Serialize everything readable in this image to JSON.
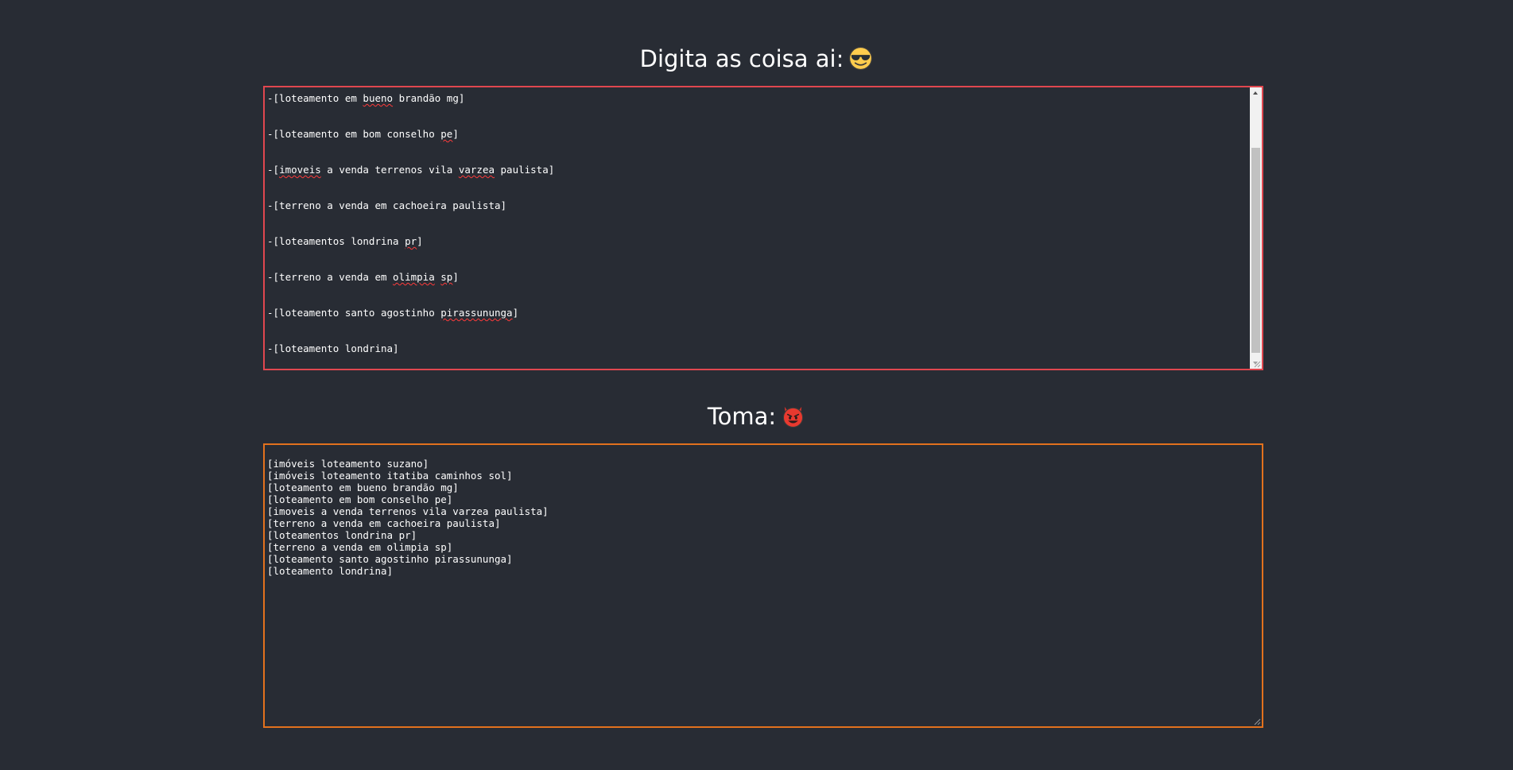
{
  "input_section": {
    "heading": "Digita as coisa ai:",
    "emoji": "smiling-face-with-sunglasses-icon",
    "border_color": "#e0474f",
    "lines": [
      [
        {
          "t": "-[loteamento em "
        },
        {
          "t": "bueno",
          "err": true
        },
        {
          "t": " brandão mg]"
        }
      ],
      [
        {
          "t": "-[loteamento em bom conselho "
        },
        {
          "t": "pe",
          "err": true
        },
        {
          "t": "]"
        }
      ],
      [
        {
          "t": "-["
        },
        {
          "t": "imoveis",
          "err": true
        },
        {
          "t": " a venda terrenos vila "
        },
        {
          "t": "varzea",
          "err": true
        },
        {
          "t": " paulista]"
        }
      ],
      [
        {
          "t": "-[terreno a venda em cachoeira paulista]"
        }
      ],
      [
        {
          "t": "-[loteamentos londrina "
        },
        {
          "t": "pr",
          "err": true
        },
        {
          "t": "]"
        }
      ],
      [
        {
          "t": "-[terreno a venda em "
        },
        {
          "t": "olimpia",
          "err": true
        },
        {
          "t": " "
        },
        {
          "t": "sp",
          "err": true
        },
        {
          "t": "]"
        }
      ],
      [
        {
          "t": "-[loteamento santo agostinho "
        },
        {
          "t": "pirassununga",
          "err": true
        },
        {
          "t": "]"
        }
      ],
      [
        {
          "t": "-[loteamento londrina]"
        }
      ]
    ]
  },
  "output_section": {
    "heading": "Toma:",
    "emoji": "smiling-face-with-horns-icon",
    "border_color": "#e2711d",
    "lines": [
      "[imóveis loteamento suzano]",
      "[imóveis loteamento itatiba caminhos sol]",
      "[loteamento em bueno brandão mg]",
      "[loteamento em bom conselho pe]",
      "[imoveis a venda terrenos vila varzea paulista]",
      "[terreno a venda em cachoeira paulista]",
      "[loteamentos londrina pr]",
      "[terreno a venda em olimpia sp]",
      "[loteamento santo agostinho pirassununga]",
      "[loteamento londrina]"
    ]
  },
  "colors": {
    "background": "#282c34",
    "text": "#ffffff",
    "spellcheck_underline": "#ff3b3b"
  }
}
